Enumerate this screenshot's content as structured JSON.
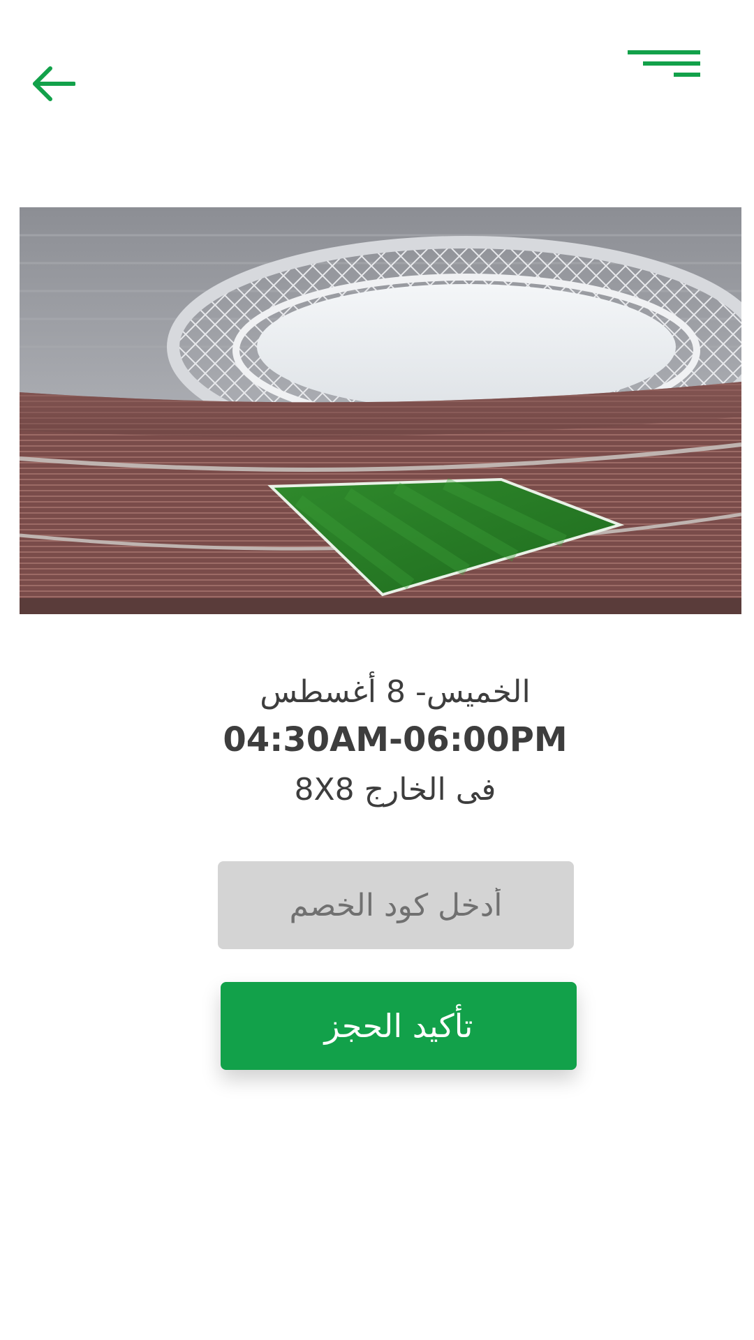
{
  "theme": {
    "accent": "#12a14a",
    "text": "#3d3d3d",
    "field_bg": "#d4d4d4"
  },
  "header": {
    "back_icon": "arrow-left-icon",
    "menu_icon": "hamburger-menu-icon"
  },
  "booking": {
    "date": "الخميس- 8 أغسطس",
    "time": "04:30AM-06:00PM",
    "venue": "فى الخارج 8X8"
  },
  "promo": {
    "placeholder": "أدخل كود الخصم",
    "value": ""
  },
  "actions": {
    "confirm_label": "تأكيد الحجز"
  }
}
